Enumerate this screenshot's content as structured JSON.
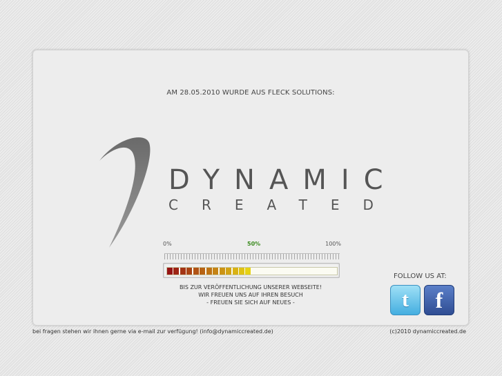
{
  "announcement": "AM 28.05.2010 WURDE AUS FLECK SOLUTIONS:",
  "brand": {
    "name": "DYNAMIC",
    "subtitle": "CREATED"
  },
  "progress": {
    "label_min": "0%",
    "label_mid": "50%",
    "label_max": "100%",
    "value_percent": 50
  },
  "status_lines": [
    "BIS ZUR VERÖFFENTLICHUNG UNSERER WEBSEITE!",
    "WIR FREUEN UNS AUF IHREN BESUCH",
    "- FREUEN SIE SICH AUF NEUES -"
  ],
  "social": {
    "follow_label": "FOLLOW US AT:",
    "twitter_icon": "twitter-icon",
    "facebook_icon": "facebook-icon"
  },
  "footer": {
    "contact": "bei fragen stehen wir ihnen gerne via e-mail zur verfügung! (info@dynamiccreated.de)",
    "copyright": "(c)2010 dynamiccreated.de"
  }
}
